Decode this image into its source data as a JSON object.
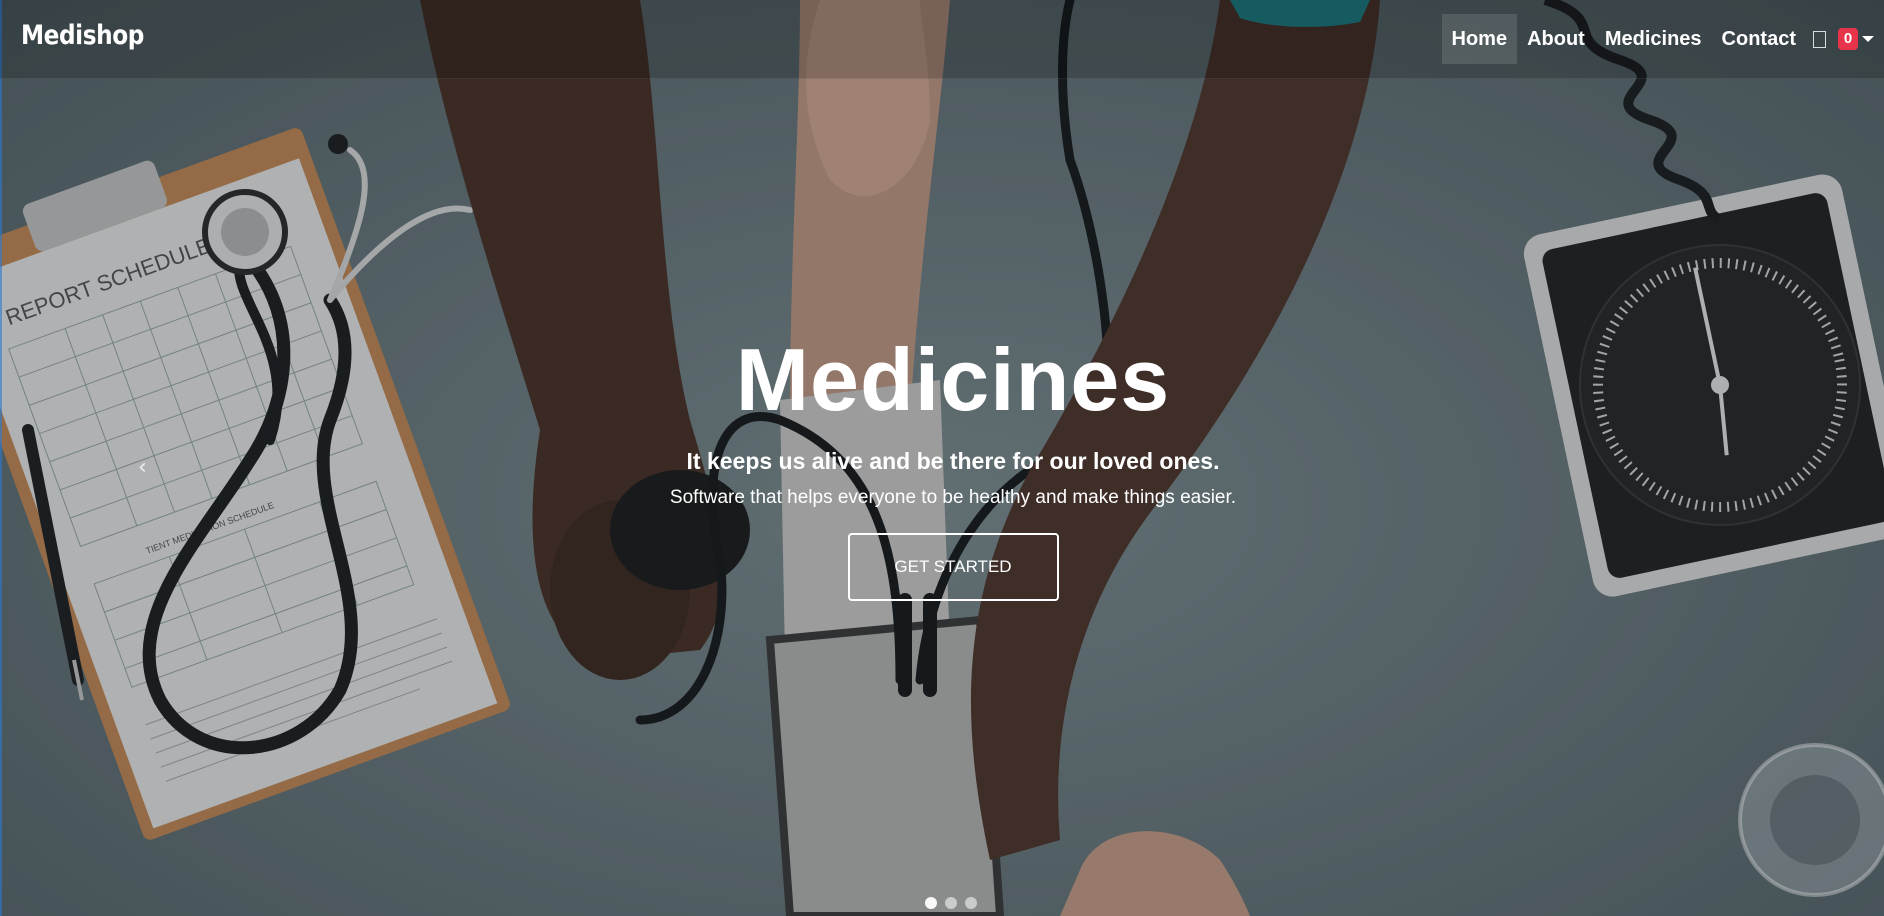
{
  "brand": {
    "name": "Medishop"
  },
  "nav": {
    "items": [
      {
        "label": "Home",
        "active": true
      },
      {
        "label": "About",
        "active": false
      },
      {
        "label": "Medicines",
        "active": false
      },
      {
        "label": "Contact",
        "active": false
      }
    ],
    "user_icon": "user-icon",
    "cart_count": "0"
  },
  "hero": {
    "title": "Medicines",
    "subtitle": "It keeps us alive and be there for our loved ones.",
    "description": "Software that helps everyone to be healthy and make things easier.",
    "button_label": "GET STARTED",
    "prev_icon": "‹",
    "slides": 3,
    "active_slide": 1
  },
  "clipboard": {
    "heading": "Y REPORT SCHEDULE",
    "subheading": "TIENT MEDICATION SCHEDULE"
  },
  "colors": {
    "accent": "#e8344a",
    "text": "#ffffff",
    "background": "#6c7b80"
  }
}
